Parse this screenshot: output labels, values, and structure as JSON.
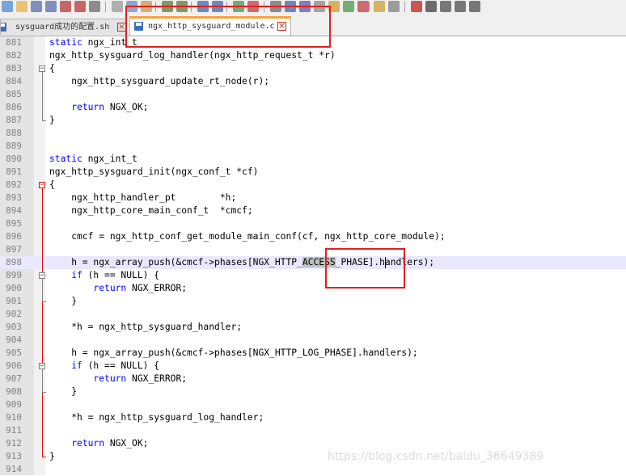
{
  "toolbar": {
    "icons": [
      "new-file-icon",
      "open-file-icon",
      "save-icon",
      "save-all-icon",
      "close-icon",
      "close-all-icon",
      "print-icon",
      "cut-icon",
      "copy-icon",
      "paste-icon",
      "undo-icon",
      "redo-icon",
      "find-icon",
      "replace-icon",
      "zoom-in-icon",
      "zoom-out-icon",
      "sync-scroll-icon",
      "wrap-icon",
      "show-all-chars-icon",
      "indent-guide-icon",
      "udl-icon",
      "doc-map-icon",
      "function-list-icon",
      "folder-workspace-icon",
      "monitor-icon",
      "record-macro-icon",
      "stop-macro-icon",
      "play-macro-icon",
      "run-macro-multiple-icon",
      "save-macro-icon"
    ]
  },
  "tabs": [
    {
      "label": "sysguard成功的配置.sh",
      "active": false
    },
    {
      "label": "ngx_http_sysguard_module.c",
      "active": true
    }
  ],
  "editor": {
    "current_line": "898",
    "lines": [
      {
        "num": "881",
        "text": "static ngx_int_t"
      },
      {
        "num": "882",
        "text": "ngx_http_sysguard_log_handler(ngx_http_request_t *r)"
      },
      {
        "num": "883",
        "text": "{"
      },
      {
        "num": "884",
        "text": "    ngx_http_sysguard_update_rt_node(r);"
      },
      {
        "num": "885",
        "text": ""
      },
      {
        "num": "886",
        "text": "    return NGX_OK;"
      },
      {
        "num": "887",
        "text": "}"
      },
      {
        "num": "888",
        "text": ""
      },
      {
        "num": "889",
        "text": ""
      },
      {
        "num": "890",
        "text": "static ngx_int_t"
      },
      {
        "num": "891",
        "text": "ngx_http_sysguard_init(ngx_conf_t *cf)"
      },
      {
        "num": "892",
        "text": "{"
      },
      {
        "num": "893",
        "text": "    ngx_http_handler_pt        *h;"
      },
      {
        "num": "894",
        "text": "    ngx_http_core_main_conf_t  *cmcf;"
      },
      {
        "num": "895",
        "text": ""
      },
      {
        "num": "896",
        "text": "    cmcf = ngx_http_conf_get_module_main_conf(cf, ngx_http_core_module);"
      },
      {
        "num": "897",
        "text": ""
      },
      {
        "num": "898",
        "text": "    h = ngx_array_push(&cmcf->phases[NGX_HTTP_ACCESS_PHASE].handlers);"
      },
      {
        "num": "899",
        "text": "    if (h == NULL) {"
      },
      {
        "num": "900",
        "text": "        return NGX_ERROR;"
      },
      {
        "num": "901",
        "text": "    }"
      },
      {
        "num": "902",
        "text": ""
      },
      {
        "num": "903",
        "text": "    *h = ngx_http_sysguard_handler;"
      },
      {
        "num": "904",
        "text": ""
      },
      {
        "num": "905",
        "text": "    h = ngx_array_push(&cmcf->phases[NGX_HTTP_LOG_PHASE].handlers);"
      },
      {
        "num": "906",
        "text": "    if (h == NULL) {"
      },
      {
        "num": "907",
        "text": "        return NGX_ERROR;"
      },
      {
        "num": "908",
        "text": "    }"
      },
      {
        "num": "909",
        "text": ""
      },
      {
        "num": "910",
        "text": "    *h = ngx_http_sysguard_log_handler;"
      },
      {
        "num": "911",
        "text": ""
      },
      {
        "num": "912",
        "text": "    return NGX_OK;"
      },
      {
        "num": "913",
        "text": "}"
      },
      {
        "num": "914",
        "text": ""
      }
    ],
    "keywords": [
      "static",
      "return",
      "if"
    ],
    "highlight_word": "ACCESS"
  },
  "watermark": "https://blog.csdn.net/baidu_36649389",
  "colors": {
    "keyword": "#0000ff",
    "active_tab_accent": "#fba03d",
    "annotation": "#e02020",
    "current_line_bg": "#e8e8ff"
  }
}
